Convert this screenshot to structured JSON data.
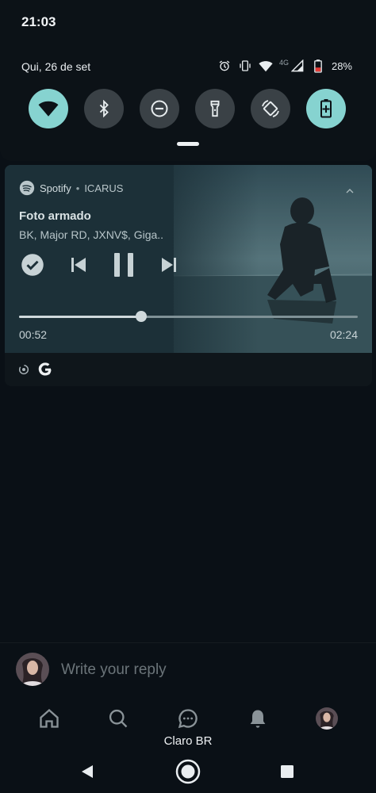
{
  "status": {
    "time": "21:03",
    "date": "Qui, 26 de set",
    "network_label": "4G",
    "battery_percent": "28%"
  },
  "quick_settings": [
    {
      "name": "wifi",
      "icon": "wifi-icon",
      "active": true
    },
    {
      "name": "bluetooth",
      "icon": "bluetooth-icon",
      "active": false
    },
    {
      "name": "do-not-disturb",
      "icon": "do-not-disturb-icon",
      "active": false
    },
    {
      "name": "flashlight",
      "icon": "flashlight-icon",
      "active": false
    },
    {
      "name": "auto-rotate",
      "icon": "auto-rotate-icon",
      "active": false
    },
    {
      "name": "battery-saver",
      "icon": "battery-saver-icon",
      "active": true
    }
  ],
  "media": {
    "app_name": "Spotify",
    "separator": "•",
    "album": "ICARUS",
    "track_title": "Foto armado",
    "artists": "BK, Major RD, JXNV$, Giga..",
    "elapsed": "00:52",
    "duration": "02:24",
    "progress_fraction": 0.361
  },
  "app": {
    "reply_placeholder": "Write your reply"
  },
  "carrier": "Claro BR",
  "colors": {
    "accent_tile": "#86d3d0",
    "inactive_tile": "#3a4146",
    "battery_low": "#e53935",
    "background": "#0a1016"
  }
}
